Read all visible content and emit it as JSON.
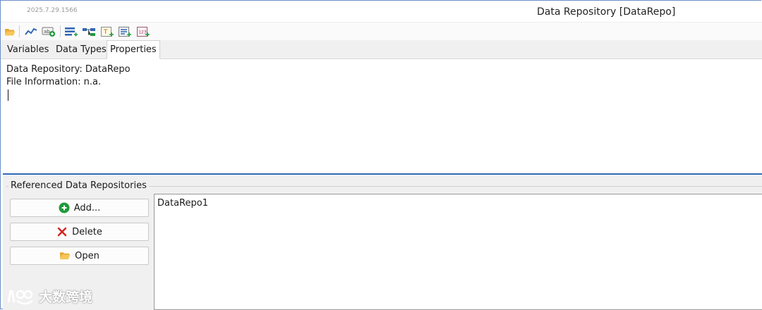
{
  "window": {
    "version": "2025.7.29.1566",
    "title": "Data Repository [DataRepo]"
  },
  "toolbar": {
    "buttons": [
      {
        "icon": "folder-open-icon"
      },
      {
        "icon": "line-chart-icon"
      },
      {
        "icon": "add-signal-icon"
      },
      {
        "icon": "add-list-icon"
      },
      {
        "icon": "tree-structure-icon"
      },
      {
        "icon": "add-text-icon"
      },
      {
        "icon": "edit-list-icon"
      },
      {
        "icon": "add-number-icon"
      }
    ]
  },
  "tabs": [
    {
      "label": "Variables",
      "active": false
    },
    {
      "label": "Data Types",
      "active": false
    },
    {
      "label": "Properties",
      "active": true
    }
  ],
  "properties": {
    "repository_line": "Data Repository: DataRepo",
    "file_info_line": "File Information: n.a."
  },
  "referenced": {
    "group_title": "Referenced Data Repositories",
    "add_label": "Add...",
    "delete_label": "Delete",
    "open_label": "Open",
    "items": [
      "DataRepo1"
    ]
  },
  "watermark": {
    "text": "大数跨境"
  },
  "colors": {
    "accent": "#2e68b8",
    "add_green": "#1f9a3a",
    "delete_red": "#d42020",
    "folder_yellow": "#f2b84b"
  }
}
